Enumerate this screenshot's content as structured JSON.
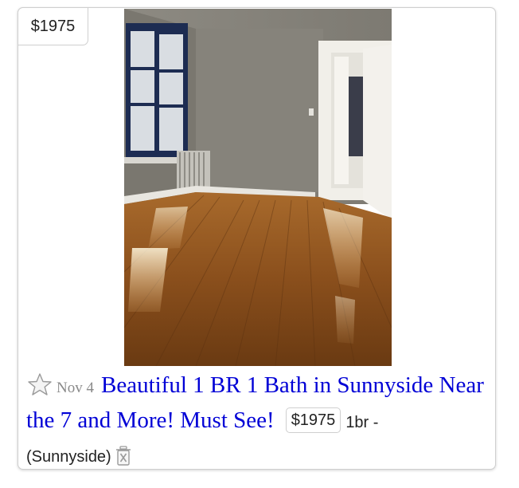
{
  "listing": {
    "price_badge": "$1975",
    "date": "Nov 4",
    "title": "Beautiful 1 BR 1 Bath in Sunnyside Near the 7 and More! Must See!",
    "inline_price": "$1975",
    "housing": "1br -",
    "neighborhood": "(Sunnyside)",
    "icons": {
      "favorite": "star-icon",
      "hide": "trash-x-icon"
    }
  },
  "colors": {
    "title_link": "#0000d6",
    "date": "#8a8a8a",
    "border": "#cfcfcf"
  }
}
